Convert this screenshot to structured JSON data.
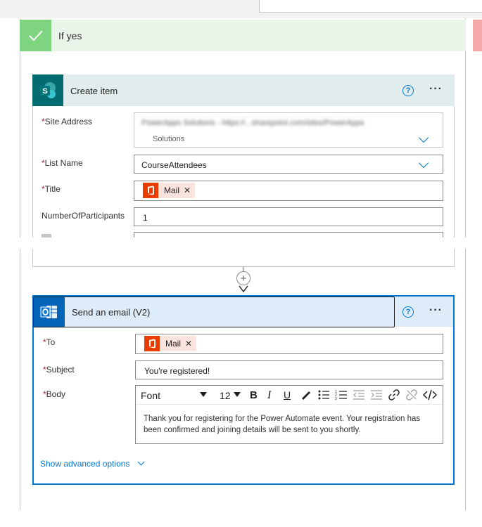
{
  "branch": {
    "title": "If yes"
  },
  "create_item": {
    "title": "Create item",
    "help_icon": "?",
    "more_icon": "···",
    "fields": {
      "site_address": {
        "label": "Site Address",
        "value_blurred": "PowerApps Solutions - https://...sharepoint.com/sites/PowerApps",
        "value_line2": "Solutions"
      },
      "list_name": {
        "label": "List Name",
        "value": "CourseAttendees"
      },
      "title": {
        "label": "Title",
        "token": "Mail"
      },
      "participants": {
        "label": "NumberOfParticipants",
        "value": "1"
      }
    }
  },
  "connector": {
    "add_symbol": "+"
  },
  "send_email": {
    "title": "Send an email (V2)",
    "help_icon": "?",
    "more_icon": "···",
    "fields": {
      "to": {
        "label": "To",
        "token": "Mail"
      },
      "subject": {
        "label": "Subject",
        "value": "You're registered!"
      },
      "body": {
        "label": "Body",
        "font": "Font",
        "size": "12",
        "text": "Thank you for registering for the Power Automate event. Your registration has been confirmed and joining details will be sent to you shortly."
      }
    },
    "advanced_link": "Show advanced options"
  },
  "required_mark": "*",
  "colors": {
    "accent": "#0078d4",
    "sharepoint": "#036c70",
    "outlook": "#0364b8",
    "office": "#eb3c00",
    "token_bg": "#fce4de",
    "yes_green": "#7fd47f"
  }
}
